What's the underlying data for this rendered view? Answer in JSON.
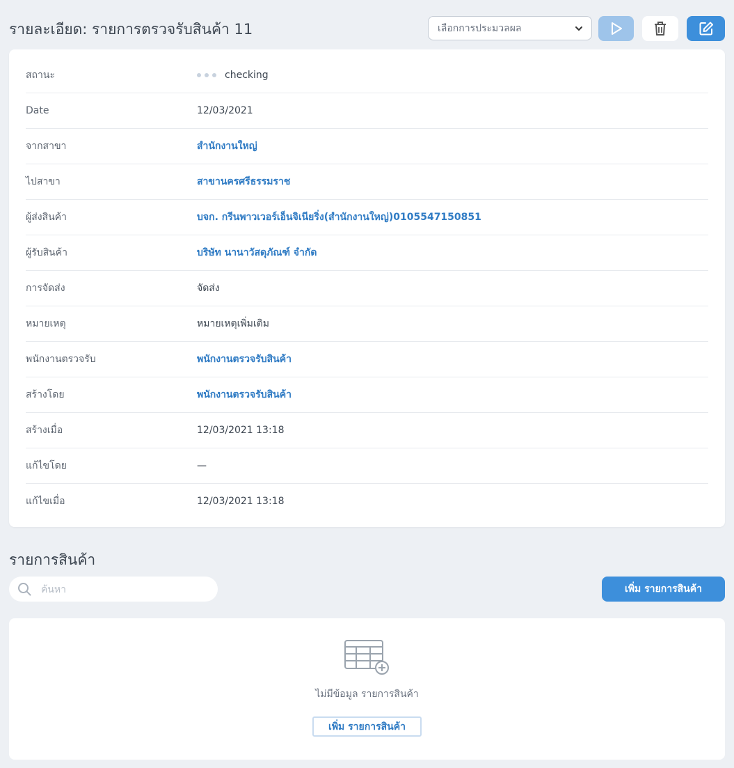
{
  "header": {
    "title": "รายละเอียด: รายการตรวจรับสินค้า 11",
    "process_select": {
      "placeholder": "เลือกการประมวลผล"
    }
  },
  "details": [
    {
      "label": "สถานะ",
      "value": "checking",
      "type": "status"
    },
    {
      "label": "Date",
      "value": "12/03/2021",
      "type": "text"
    },
    {
      "label": "จากสาขา",
      "value": "สำนักงานใหญ่",
      "type": "link"
    },
    {
      "label": "ไปสาขา",
      "value": "สาขานครศรีธรรมราช",
      "type": "link"
    },
    {
      "label": "ผู้ส่งสินค้า",
      "value": "บจก. กรีนพาวเวอร์เอ็นจิเนียริ่ง(สำนักงานใหญ่)0105547150851",
      "type": "link"
    },
    {
      "label": "ผู้รับสินค้า",
      "value": "บริษัท นานาวัสดุภัณฑ์ จำกัด",
      "type": "link"
    },
    {
      "label": "การจัดส่ง",
      "value": "จัดส่ง",
      "type": "text"
    },
    {
      "label": "หมายเหตุ",
      "value": "หมายเหตุเพิ่มเติม",
      "type": "text"
    },
    {
      "label": "พนักงานตรวจรับ",
      "value": "พนักงานตรวจรับสินค้า",
      "type": "link"
    },
    {
      "label": "สร้างโดย",
      "value": "พนักงานตรวจรับสินค้า",
      "type": "link"
    },
    {
      "label": "สร้างเมื่อ",
      "value": "12/03/2021 13:18",
      "type": "text"
    },
    {
      "label": "แก้ไขโดย",
      "value": "—",
      "type": "text"
    },
    {
      "label": "แก้ไขเมื่อ",
      "value": "12/03/2021 13:18",
      "type": "text"
    }
  ],
  "items": {
    "title": "รายการสินค้า",
    "search_placeholder": "ค้นหา",
    "add_button": "เพิ่ม รายการสินค้า",
    "empty_text": "ไม่มีข้อมูล รายการสินค้า",
    "empty_add_button": "เพิ่ม รายการสินค้า"
  },
  "icons": {
    "run": "play-icon",
    "delete": "trash-icon",
    "edit": "edit-icon",
    "select": "chevron-down-icon",
    "search": "search-icon",
    "empty": "table-add-icon"
  },
  "colors": {
    "primary": "#3d8fdb",
    "primary_disabled": "#9ec4ea",
    "link": "#2f7bc4",
    "background": "#edf0f4"
  }
}
